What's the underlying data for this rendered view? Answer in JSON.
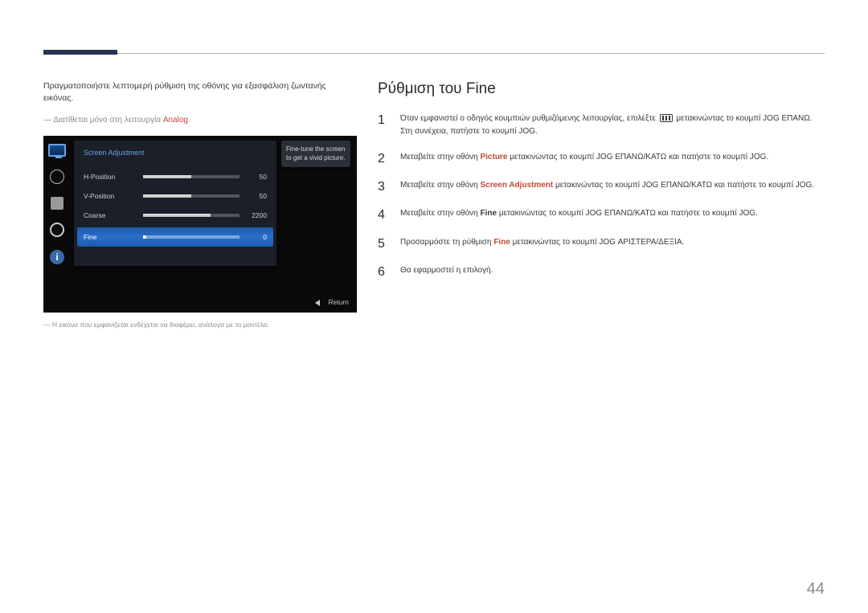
{
  "header": {},
  "left": {
    "intro": "Πραγματοποιήστε λεπτομερή ρύθμιση της οθόνης για εξασφάλιση ζωντανής εικόνας.",
    "analog_note_prefix": "― Διατίθεται μόνο στη λειτουργία ",
    "analog_word": "Analog",
    "analog_dot": ".",
    "model_note": "― Η εικόνα που εμφανίζεται ενδέχεται να διαφέρει, ανάλογα με το μοντέλο."
  },
  "osd": {
    "title": "Screen Adjustment",
    "rows": {
      "h": {
        "label": "H-Position",
        "value": "50",
        "fill_pct": 50
      },
      "v": {
        "label": "V-Position",
        "value": "50",
        "fill_pct": 50
      },
      "c": {
        "label": "Coarse",
        "value": "2200",
        "fill_pct": 70
      },
      "f": {
        "label": "Fine",
        "value": "0",
        "fill_pct": 3
      }
    },
    "tooltip": "Fine-tune the screen to get a vivid picture.",
    "return": "Return"
  },
  "right": {
    "title": "Ρύθμιση του Fine",
    "steps": [
      {
        "num": "1",
        "pre": "Όταν εμφανιστεί ο οδηγός κουμπιών ρυθμιζόμενης λειτουργίας, επιλέξτε ",
        "has_icon": true,
        "post": " μετακινώντας το κουμπί JOG ΕΠΑΝΩ. Στη συνέχεια, πατήστε το κουμπί JOG."
      },
      {
        "num": "2",
        "pre": "Μεταβείτε στην οθόνη ",
        "hl": "Picture",
        "hl_class": "hl-picture",
        "post": " μετακινώντας το κουμπί JOG ΕΠΑΝΩ/ΚΑΤΩ και πατήστε το κουμπί JOG."
      },
      {
        "num": "3",
        "pre": "Μεταβείτε στην οθόνη ",
        "hl": "Screen Adjustment",
        "hl_class": "hl-screenadj",
        "post": " μετακινώντας το κουμπί JOG ΕΠΑΝΩ/ΚΑΤΩ και πατήστε το κουμπί JOG."
      },
      {
        "num": "4",
        "pre": "Μεταβείτε στην οθόνη ",
        "hl": "Fine",
        "hl_class": "bold",
        "post": " μετακινώντας το κουμπί JOG ΕΠΑΝΩ/ΚΑΤΩ και πατήστε το κουμπί JOG."
      },
      {
        "num": "5",
        "pre": "Προσαρμόστε τη ρύθμιση ",
        "hl": "Fine",
        "hl_class": "hl-fine",
        "post": " μετακινώντας το κουμπί JOG ΑΡΙΣΤΕΡΑ/ΔΕΞΙΑ."
      },
      {
        "num": "6",
        "pre": "Θα εφαρμοστεί η επιλογή.",
        "post": ""
      }
    ]
  },
  "page_number": "44"
}
